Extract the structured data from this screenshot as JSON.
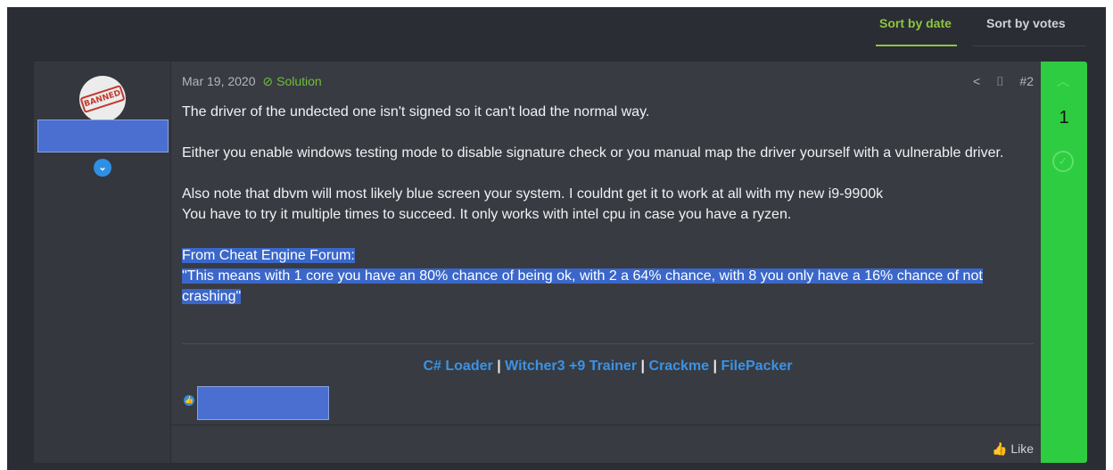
{
  "tabs": {
    "sort_date": "Sort by date",
    "sort_votes": "Sort by votes"
  },
  "post": {
    "date": "Mar 19, 2020",
    "solution_label": "Solution",
    "post_number": "#2",
    "banned_stamp": "BANNED",
    "paragraphs": [
      "The driver of the undected one isn't signed so it can't load the normal way.",
      "Either you enable windows testing mode to disable signature check or you manual map the driver yourself with a vulnerable driver.",
      "Also note that dbvm will most likely blue screen your system. I couldnt get it to work at all with my new i9-9900k",
      "You have to try it multiple times to succeed. It only works with intel cpu in case you have a ryzen."
    ],
    "quote_source": "From Cheat Engine Forum:",
    "quote_text": "\"This means with 1 core you have an 80% chance of being ok, with 2 a 64% chance, with 8 you only have a 16% chance of not crashing\"",
    "signature": {
      "links": [
        "C# Loader",
        "Witcher3 +9 Trainer",
        "Crackme",
        "FilePacker"
      ],
      "separator": "|"
    },
    "like_label": "Like"
  },
  "votes": {
    "count": "1"
  },
  "icons": [
    "banned-avatar",
    "chevron-down-icon",
    "check-circle-icon",
    "share-icon",
    "bookmark-icon",
    "thumbs-up-icon",
    "chevron-up-icon"
  ],
  "colors": {
    "accent": "#8dc63f",
    "vote_bg": "#2ecc40",
    "link": "#3a93e6",
    "highlight": "#3a67c9"
  }
}
